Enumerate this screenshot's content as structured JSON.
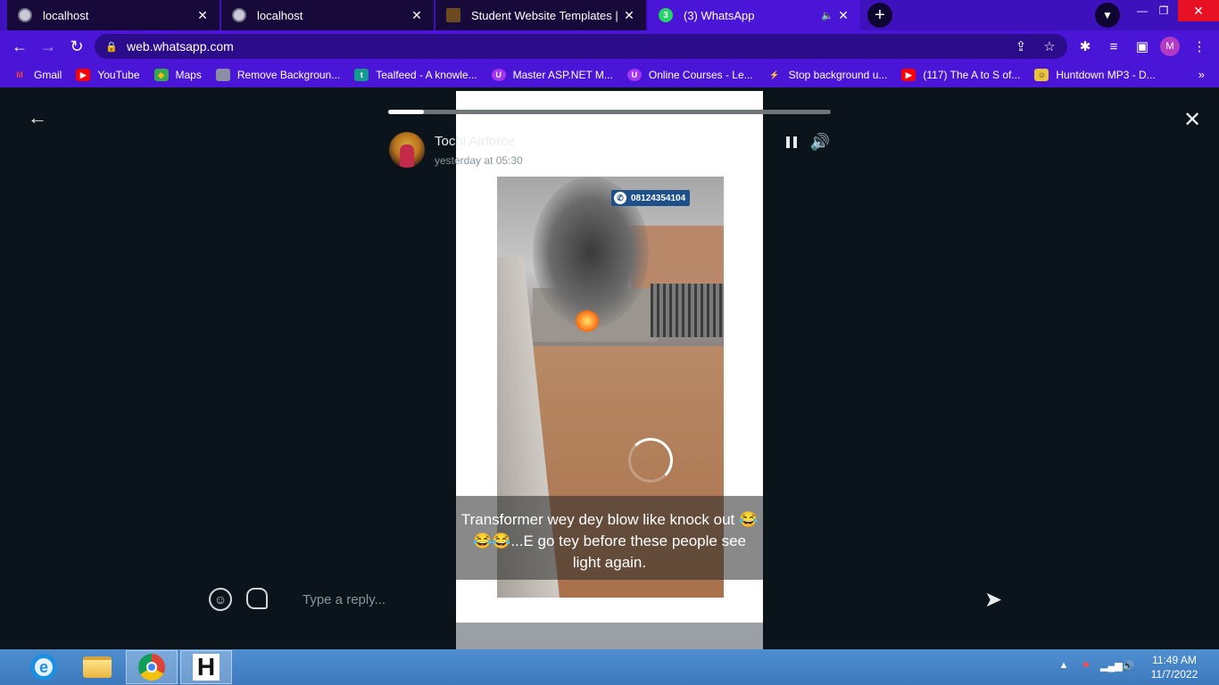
{
  "browser": {
    "tabs": [
      {
        "title": "localhost",
        "favicon": "globe-icon",
        "active": false
      },
      {
        "title": "localhost",
        "favicon": "globe-icon",
        "active": false
      },
      {
        "title": "Student Website Templates | The",
        "favicon": "templatemonster-icon",
        "active": false
      },
      {
        "title": "(3) WhatsApp",
        "favicon": "whatsapp-icon",
        "badge": "3",
        "active": true,
        "audio": true
      }
    ],
    "url": "web.whatsapp.com",
    "profile_initial": "M",
    "bookmarks": [
      {
        "label": "Gmail",
        "icon": "gmail-icon"
      },
      {
        "label": "YouTube",
        "icon": "youtube-icon"
      },
      {
        "label": "Maps",
        "icon": "maps-icon"
      },
      {
        "label": "Remove Backgroun...",
        "icon": "remove-bg-icon"
      },
      {
        "label": "Tealfeed - A knowle...",
        "icon": "tealfeed-icon"
      },
      {
        "label": "Master ASP.NET M...",
        "icon": "udemy-icon"
      },
      {
        "label": "Online Courses - Le...",
        "icon": "udemy-icon"
      },
      {
        "label": "Stop background u...",
        "icon": "stop-icon"
      },
      {
        "label": "(117) The A to S of...",
        "icon": "youtube-icon"
      },
      {
        "label": "Huntdown MP3 - D...",
        "icon": "huntdown-icon"
      }
    ]
  },
  "status": {
    "author": "Tochi Airforce",
    "timestamp": "yesterday at 05:30",
    "progress": 0.08,
    "watermark": "08124354104",
    "caption": "Transformer wey dey blow like knock out 😂😂😂...E go tey before these people see light again.",
    "reply_placeholder": "Type a reply..."
  },
  "taskbar": {
    "time": "11:49 AM",
    "date": "11/7/2022"
  },
  "colors": {
    "tab_strip": "#3d12bd",
    "toolbar": "#4a15d6",
    "viewer_bg": "#0b141a",
    "taskbar": "#3c79bd"
  }
}
